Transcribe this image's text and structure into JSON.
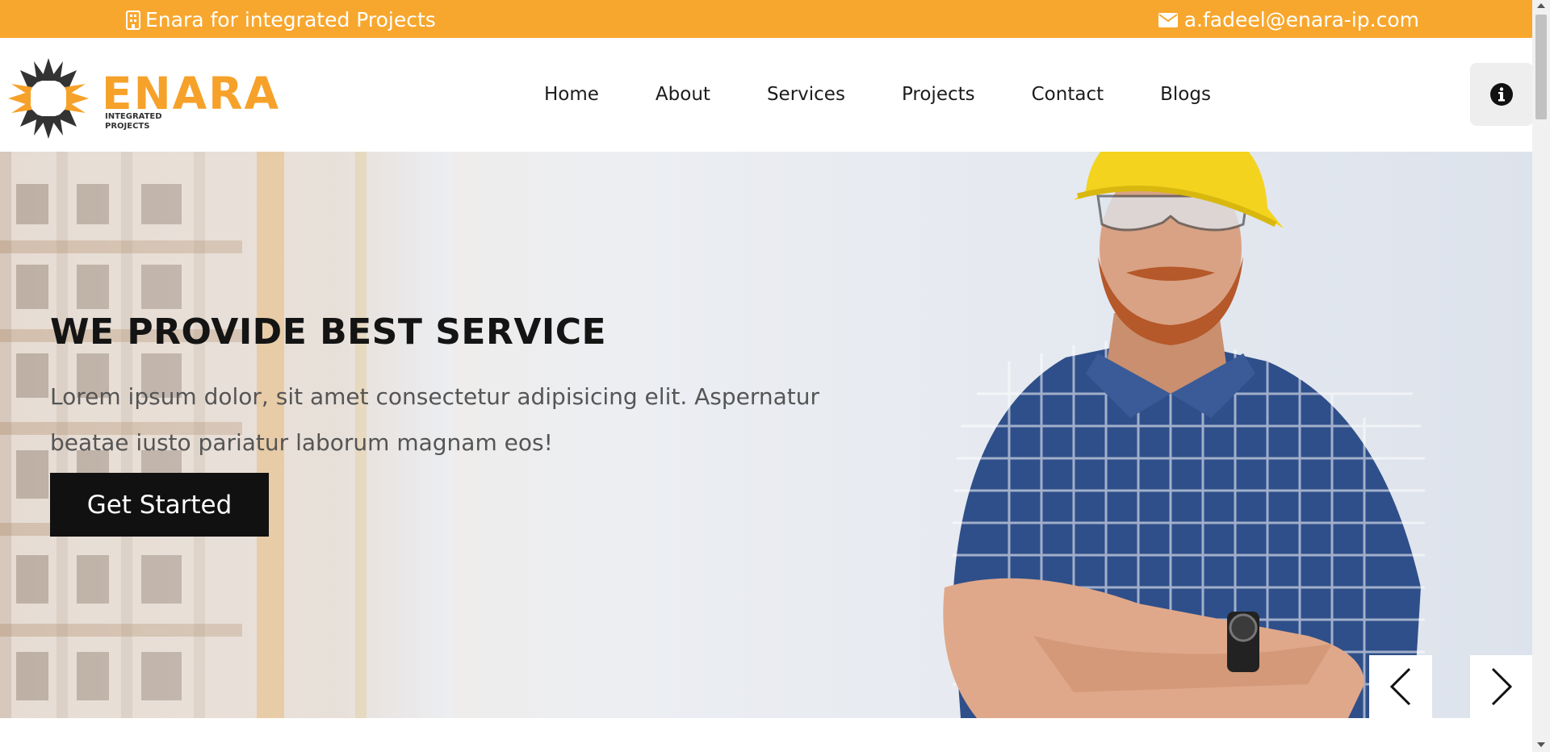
{
  "topbar": {
    "company_label": "Enara for integrated Projects",
    "email": "a.fadeel@enara-ip.com",
    "background_color": "#F8A72E",
    "company_icon": "building-icon",
    "email_icon": "envelope-icon"
  },
  "header": {
    "logo_brand": "ENARA",
    "logo_sub_line1": "INTEGRATED",
    "logo_sub_line2": "PROJECTS",
    "nav": [
      {
        "label": "Home"
      },
      {
        "label": "About"
      },
      {
        "label": "Services"
      },
      {
        "label": "Projects"
      },
      {
        "label": "Contact"
      },
      {
        "label": "Blogs"
      }
    ],
    "info_icon": "info-icon"
  },
  "hero": {
    "title": "WE PROVIDE BEST SERVICE",
    "text": "Lorem ipsum dolor, sit amet consectetur adipisicing elit. Aspernatur beatae iusto pariatur laborum magnam eos!",
    "cta_label": "Get Started",
    "prev_icon": "chevron-left-icon",
    "next_icon": "chevron-right-icon"
  },
  "colors": {
    "accent": "#F8A72E",
    "dark": "#111111"
  }
}
